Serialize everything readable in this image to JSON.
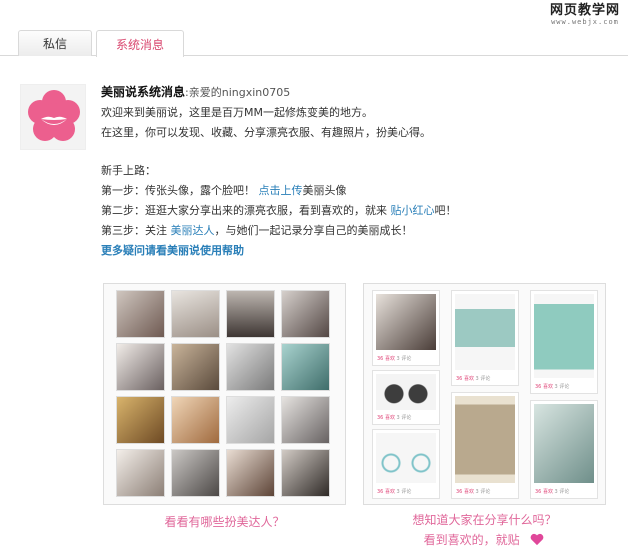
{
  "watermark": {
    "cn": "网页教学网",
    "en": "www.webjx.com"
  },
  "tabs": [
    {
      "label": "私信"
    },
    {
      "label": "系统消息"
    }
  ],
  "message": {
    "sender": "美丽说系统消息",
    "greeting": ":亲爱的ningxin0705",
    "welcome_line1": "欢迎来到美丽说，这里是百万MM一起修炼变美的地方。",
    "welcome_line2": "在这里，你可以发现、收藏、分享漂亮衣服、有趣照片，扮美心得。",
    "newbie_heading": "新手上路：",
    "step1": {
      "prefix": "第一步：传张头像，露个脸吧！",
      "link": "点击上传",
      "suffix": "美丽头像"
    },
    "step2": {
      "prefix": "第二步：逛逛大家分享出来的漂亮衣服，看到喜欢的，就来 ",
      "link": "贴小红心",
      "suffix": "吧！"
    },
    "step3": {
      "prefix": "第三步：关注 ",
      "link": "美丽达人",
      "suffix": "，与她们一起记录分享自己的美丽成长！"
    },
    "help_link": "更多疑问请看美丽说使用帮助"
  },
  "feed_meta": {
    "likes": "36 喜欢",
    "comments": "3 评论"
  },
  "captions": {
    "left": "看看有哪些扮美达人？",
    "right_line1": "想知道大家在分享什么吗？",
    "right_line2": "看到喜欢的，就贴"
  },
  "colors": {
    "accent_pink": "#e0679a",
    "link_blue": "#2a7fb8",
    "tab_active_text": "#d9476f"
  },
  "icons": [
    "flower-logo-icon",
    "heart-icon"
  ]
}
